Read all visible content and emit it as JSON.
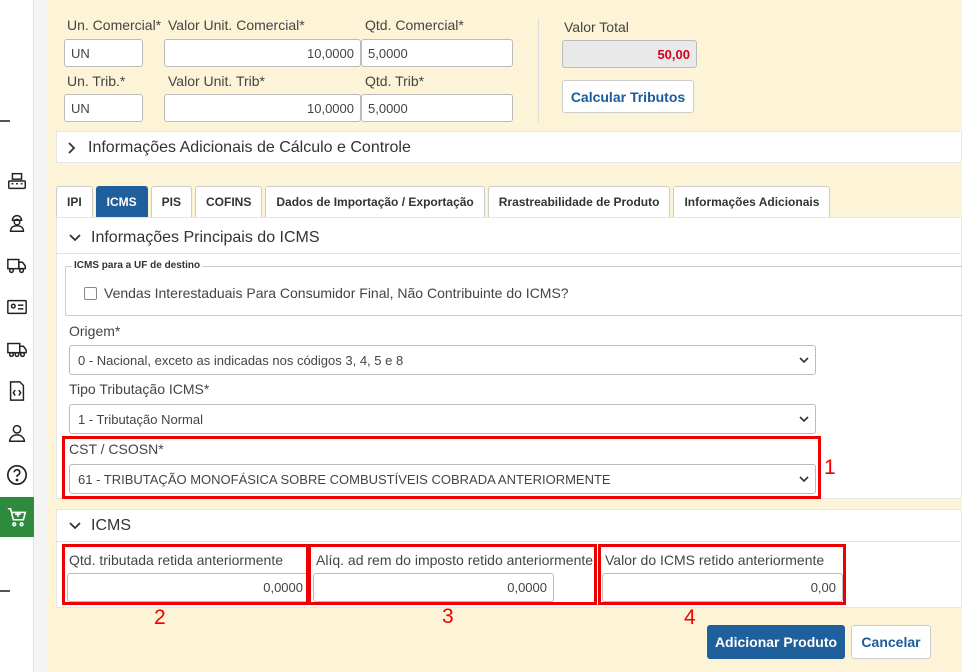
{
  "sidebar": {
    "icons": [
      "cash-register-icon",
      "worker-icon",
      "delivery-truck-icon",
      "id-card-icon",
      "truck-icon",
      "code-file-icon",
      "user-icon",
      "help-icon",
      "cart-plus-icon"
    ]
  },
  "top_fields": {
    "un_comercial_label": "Un. Comercial*",
    "un_comercial_value": "UN",
    "valor_unit_comercial_label": "Valor Unit. Comercial*",
    "valor_unit_comercial_value": "10,0000",
    "qtd_comercial_label": "Qtd. Comercial*",
    "qtd_comercial_value": "5,0000",
    "un_trib_label": "Un. Trib.*",
    "un_trib_value": "UN",
    "valor_unit_trib_label": "Valor Unit. Trib*",
    "valor_unit_trib_value": "10,0000",
    "qtd_trib_label": "Qtd. Trib*",
    "qtd_trib_value": "5,0000",
    "valor_total_label": "Valor Total",
    "valor_total_value": "50,00",
    "calcular_button": "Calcular Tributos"
  },
  "info_adicionais_calculo": "Informações Adicionais de Cálculo e Controle",
  "tabs": [
    "IPI",
    "ICMS",
    "PIS",
    "COFINS",
    "Dados de Importação / Exportação",
    "Rrastreabilidade de Produto",
    "Informações Adicionais"
  ],
  "icms_principal": {
    "title": "Informações Principais do ICMS",
    "fieldset_legend": "ICMS para a UF de destino",
    "checkbox_label": "Vendas Interestaduais Para Consumidor Final, Não Contribuinte do ICMS?",
    "origem_label": "Origem*",
    "origem_value": "0 - Nacional, exceto as indicadas nos códigos 3, 4, 5 e 8",
    "tipo_label": "Tipo Tributação ICMS*",
    "tipo_value": "1 - Tributação Normal",
    "cst_label": "CST / CSOSN*",
    "cst_value": "61 - TRIBUTAÇÃO MONOFÁSICA SOBRE COMBUSTÍVEIS COBRADA ANTERIORMENTE"
  },
  "icms_section": {
    "title": "ICMS",
    "qtd_label": "Qtd. tributada retida anteriormente",
    "qtd_value": "0,0000",
    "aliq_label": "Alíq. ad rem do imposto retido anteriormente",
    "aliq_value": "0,0000",
    "valor_label": "Valor do ICMS retido anteriormente",
    "valor_value": "0,00"
  },
  "annotations": [
    "1",
    "2",
    "3",
    "4"
  ],
  "actions": {
    "add_button": "Adicionar Produto",
    "cancel_button": "Cancelar"
  },
  "colors": {
    "accent": "#1f5f9b",
    "annotation": "#e00000",
    "sidebar_active": "#2e8b3e",
    "total": "#d0021b"
  }
}
